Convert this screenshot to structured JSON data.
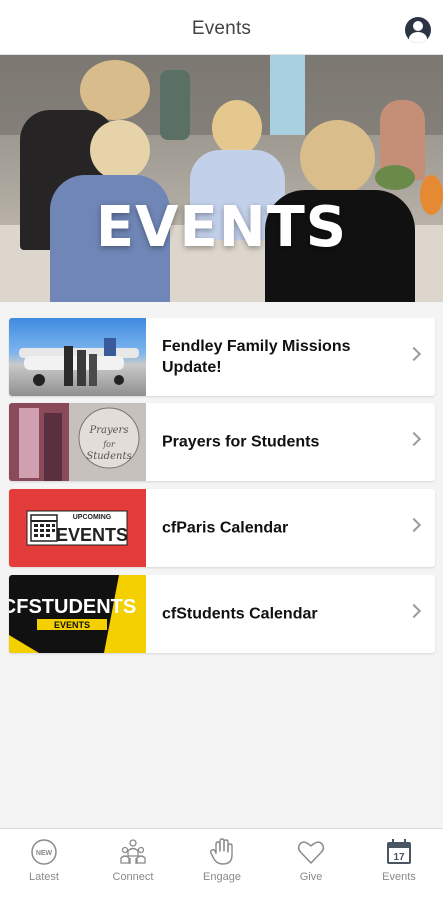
{
  "header": {
    "title": "Events",
    "profile_icon": "profile-icon"
  },
  "hero": {
    "banner_text": "EVENTS"
  },
  "events": [
    {
      "title": "Fendley Family Missions Update!",
      "thumb_icon": "airplane-photo"
    },
    {
      "title": "Prayers for Students",
      "thumb_icon": "prayers-photo",
      "thumb_text": "Prayers for Students"
    },
    {
      "title": "cfParis Calendar",
      "thumb_icon": "upcoming-events-graphic",
      "thumb_text_top": "UPCOMING",
      "thumb_text_main": "EVENTS"
    },
    {
      "title": "cfStudents Calendar",
      "thumb_icon": "cfstudents-graphic",
      "thumb_text_main": "CFSTUDENTS",
      "thumb_text_sub": "EVENTS"
    }
  ],
  "tabs": [
    {
      "label": "Latest",
      "icon": "new-badge-icon",
      "badge": "NEW"
    },
    {
      "label": "Connect",
      "icon": "people-icon"
    },
    {
      "label": "Engage",
      "icon": "hand-icon"
    },
    {
      "label": "Give",
      "icon": "heart-icon"
    },
    {
      "label": "Events",
      "icon": "calendar-icon",
      "calendar_day": "17"
    }
  ],
  "colors": {
    "accent_red": "#e43b3b",
    "accent_yellow": "#f4d000",
    "tab_icon": "#8a8a8a",
    "active_icon": "#4a5563"
  }
}
